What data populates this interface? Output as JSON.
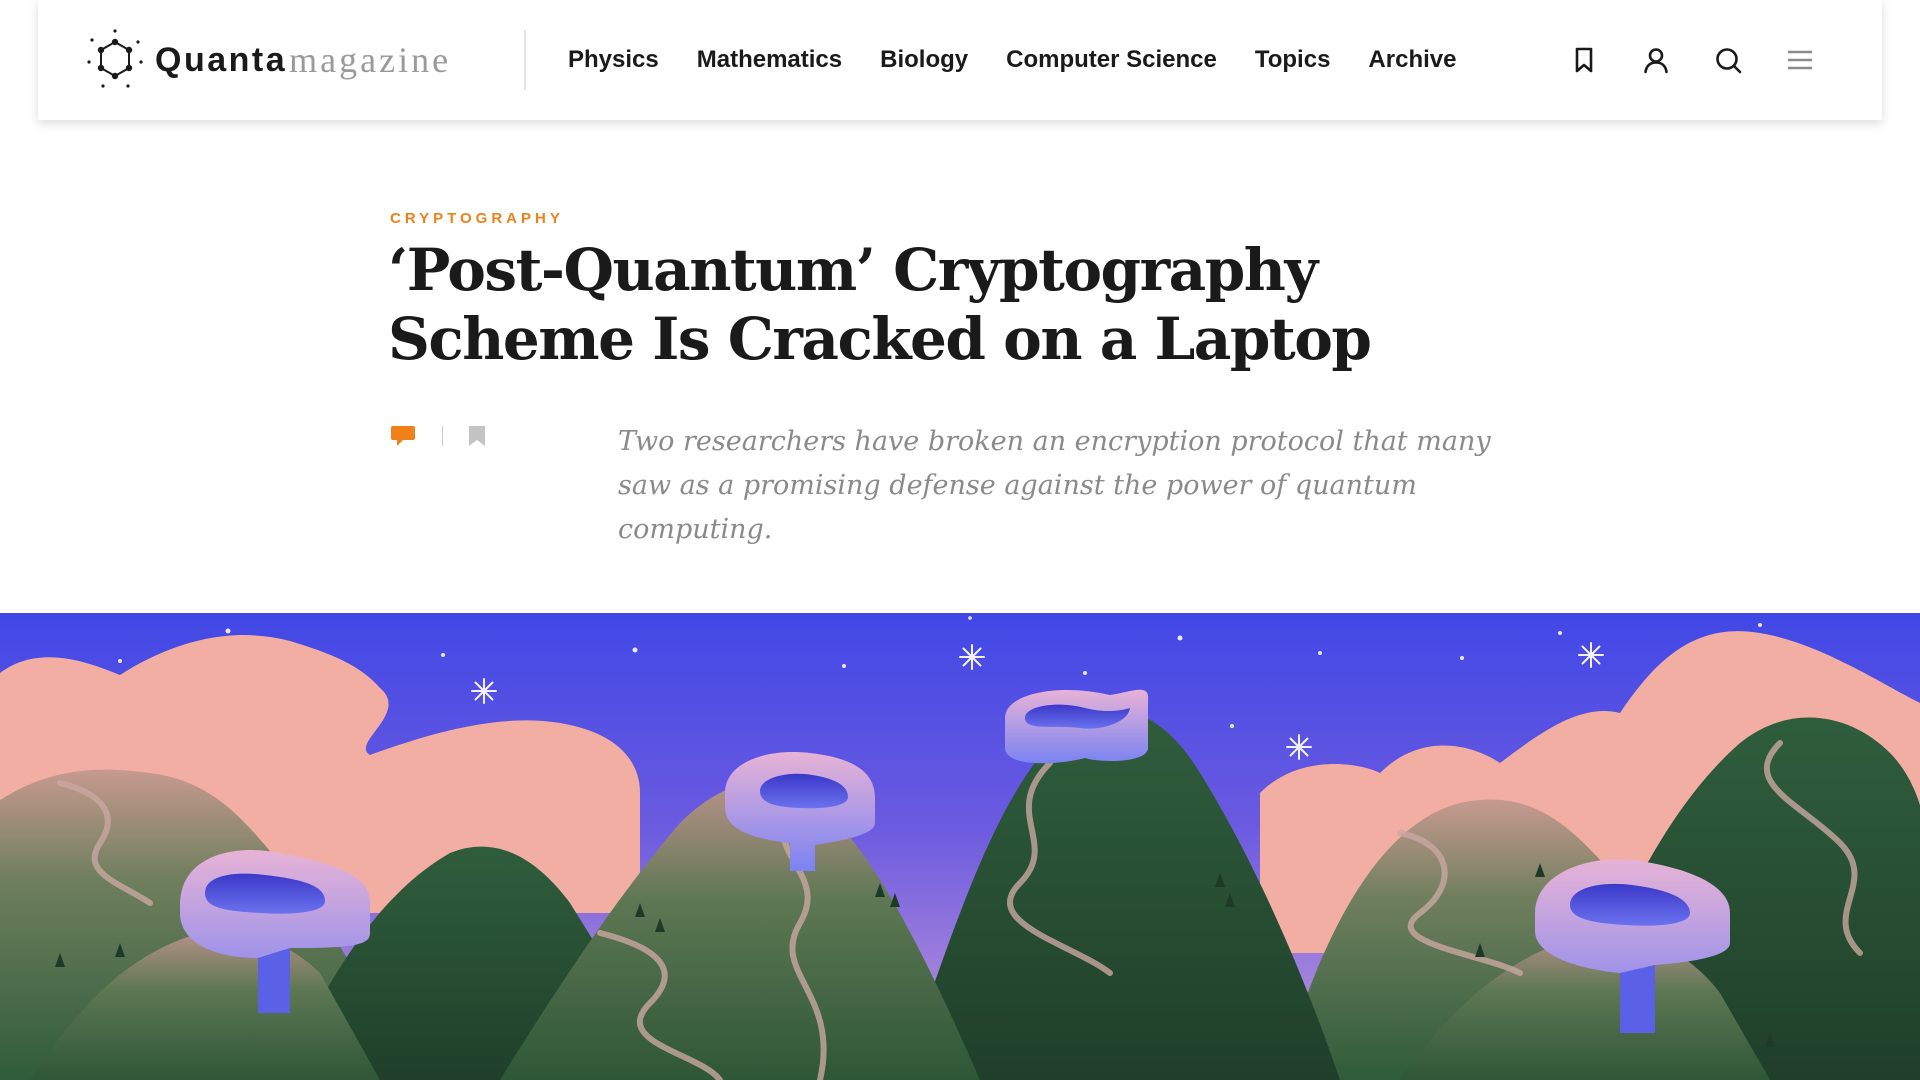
{
  "header": {
    "logo": {
      "brand": "Quanta",
      "suffix": "magazine"
    },
    "nav": [
      {
        "label": "Physics"
      },
      {
        "label": "Mathematics"
      },
      {
        "label": "Biology"
      },
      {
        "label": "Computer Science"
      },
      {
        "label": "Topics"
      },
      {
        "label": "Archive"
      }
    ],
    "icons": [
      "bookmark-icon",
      "user-icon",
      "search-icon",
      "menu-icon"
    ]
  },
  "article": {
    "kicker": "CRYPTOGRAPHY",
    "title": "‘Post-Quantum’ Cryptography Scheme Is Cracked on a Laptop",
    "dek": "Two researchers have broken an encryption protocol that many saw as a promising defense against the power of quantum computing.",
    "meta_icons": [
      "comment-icon",
      "bookmark-icon"
    ]
  },
  "hero": {
    "description_icon": "illustration",
    "colors": {
      "sky": "#4a55e8",
      "clouds": "#f3b0a4",
      "hills": "#3d6b45",
      "accent": "#f08018"
    }
  }
}
